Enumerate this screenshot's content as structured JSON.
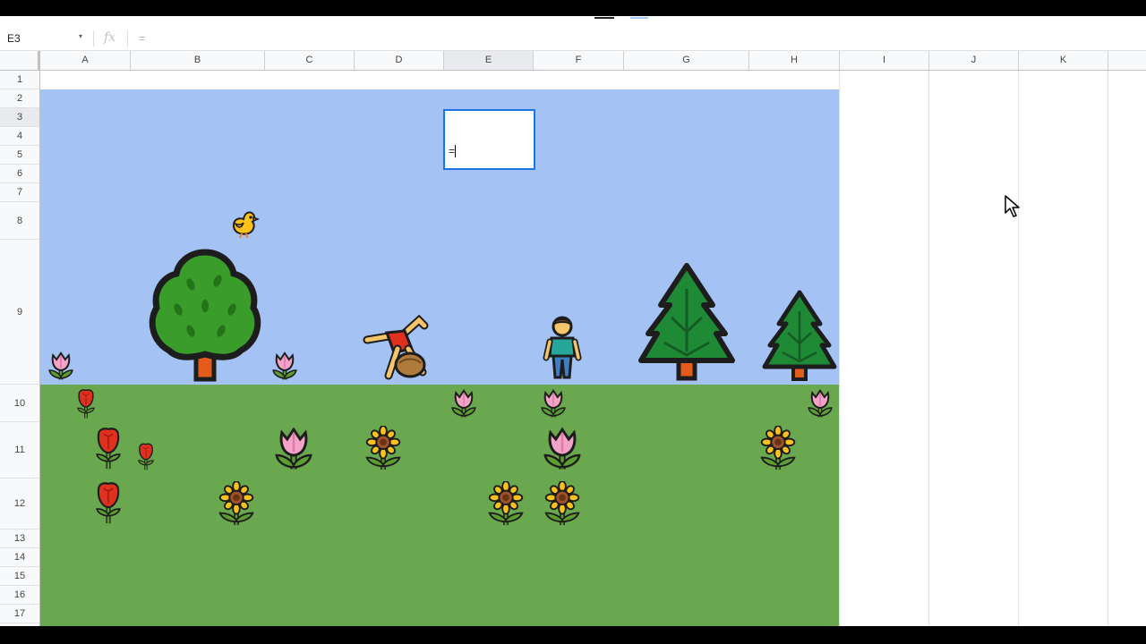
{
  "formula_bar": {
    "name_box": "E3",
    "name_box_arrow": "▾",
    "fx_label": "fx",
    "formula": "="
  },
  "columns": [
    "A",
    "B",
    "C",
    "D",
    "E",
    "F",
    "G",
    "H",
    "I",
    "J",
    "K"
  ],
  "rows": [
    "1",
    "2",
    "3",
    "4",
    "5",
    "6",
    "7",
    "8",
    "9",
    "10",
    "11",
    "12",
    "13",
    "14",
    "15",
    "16",
    "17"
  ],
  "selected_cell": {
    "ref": "E3",
    "content": "="
  },
  "scene": {
    "sky_color": "#a4c2f4",
    "grass_color": "#6aa84f",
    "sprites": [
      "chick",
      "deciduous-tree",
      "person-cartwheeling",
      "person-standing",
      "evergreen-tree",
      "tulip",
      "rose",
      "sunflower"
    ]
  },
  "colors": {
    "selection_border": "#1a73e8",
    "header_bg": "#f8f9fa"
  }
}
